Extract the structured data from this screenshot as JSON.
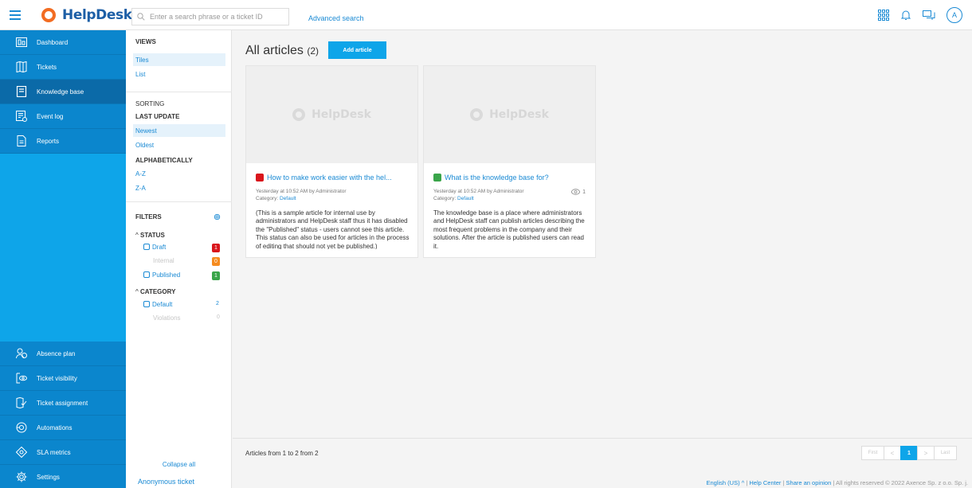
{
  "header": {
    "logo_text": "HelpDesk",
    "search_placeholder": "Enter a search phrase or a ticket ID",
    "advanced_search": "Advanced search",
    "avatar_letter": "A"
  },
  "sidebar": {
    "top_items": [
      {
        "label": "Dashboard",
        "icon": "dashboard-icon"
      },
      {
        "label": "Tickets",
        "icon": "tickets-icon"
      },
      {
        "label": "Knowledge base",
        "icon": "book-icon",
        "active": true
      },
      {
        "label": "Event log",
        "icon": "event-log-icon"
      },
      {
        "label": "Reports",
        "icon": "reports-icon"
      }
    ],
    "bottom_items": [
      {
        "label": "Absence plan",
        "icon": "absence-icon"
      },
      {
        "label": "Ticket visibility",
        "icon": "visibility-icon"
      },
      {
        "label": "Ticket assignment",
        "icon": "assignment-icon"
      },
      {
        "label": "Automations",
        "icon": "automations-icon"
      },
      {
        "label": "SLA metrics",
        "icon": "sla-icon"
      },
      {
        "label": "Settings",
        "icon": "gear-icon"
      }
    ]
  },
  "panel": {
    "views_heading": "VIEWS",
    "views": [
      "Tiles",
      "List"
    ],
    "sorting_heading": "SORTING",
    "last_update_heading": "LAST UPDATE",
    "last_update_options": [
      "Newest",
      "Oldest"
    ],
    "alpha_heading": "ALPHABETICALLY",
    "alpha_options": [
      "A-Z",
      "Z-A"
    ],
    "filters_heading": "FILTERS",
    "status_heading": "STATUS",
    "status_items": [
      {
        "label": "Draft",
        "count": "1",
        "color": "#d9161c"
      },
      {
        "label": "Internal",
        "count": "0",
        "color": "#f58b1f"
      },
      {
        "label": "Published",
        "count": "1",
        "color": "#3aa54a"
      }
    ],
    "category_heading": "CATEGORY",
    "category_items": [
      {
        "label": "Default",
        "count": "2"
      },
      {
        "label": "Violations",
        "count": "0"
      }
    ],
    "collapse_all": "Collapse all",
    "anonymous_ticket": "Anonymous ticket"
  },
  "main": {
    "title": "All articles",
    "count": "(2)",
    "add_button": "Add article",
    "articles": [
      {
        "title": "How to make work easier with the hel...",
        "status_color": "#d9161c",
        "meta": "Yesterday at 10:52 AM by Administrator",
        "category_label": "Category:",
        "category": "Default",
        "views": "",
        "body": "(This is a sample article for internal use by administrators and HelpDesk staff thus it has disabled the \"Published\" status - users cannot see this article. This status can also be used for articles in the process of editing that should not yet be published.)"
      },
      {
        "title": "What is the knowledge base for?",
        "status_color": "#3aa54a",
        "meta": "Yesterday at 10:52 AM by Administrator",
        "category_label": "Category:",
        "category": "Default",
        "views": "1",
        "body": "The knowledge base is a place where administrators and HelpDesk staff can publish articles describing the most frequent problems in the company and their solutions. After the article is published users can read it."
      }
    ],
    "articles_count": "Articles from 1 to 2 from 2",
    "pager": {
      "first": "First",
      "prev": "<",
      "current": "1",
      "next": ">",
      "last": "Last"
    }
  },
  "footer": {
    "language": "English (US)",
    "help_center": "Help Center",
    "share_opinion": "Share an opinion",
    "rights": "All rights reserved © 2022 Axence Sp. z o.o. Sp. j."
  }
}
